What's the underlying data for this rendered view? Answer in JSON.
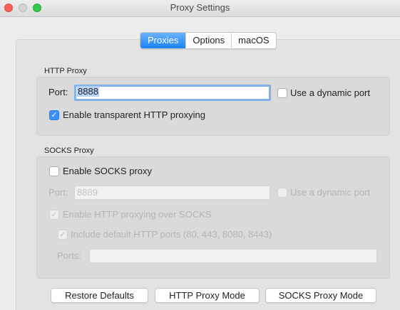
{
  "window": {
    "title": "Proxy Settings"
  },
  "tabs": [
    {
      "label": "Proxies",
      "active": true
    },
    {
      "label": "Options",
      "active": false
    },
    {
      "label": "macOS",
      "active": false
    }
  ],
  "http_proxy": {
    "group_label": "HTTP Proxy",
    "port_label": "Port:",
    "port_value": "8888",
    "dynamic_port_label": "Use a dynamic port",
    "dynamic_port_checked": false,
    "transparent_label": "Enable transparent HTTP proxying",
    "transparent_checked": true
  },
  "socks_proxy": {
    "group_label": "SOCKS Proxy",
    "enable_label": "Enable SOCKS proxy",
    "enable_checked": false,
    "port_label": "Port:",
    "port_value": "8889",
    "dynamic_port_label": "Use a dynamic port",
    "http_over_socks_label": "Enable HTTP proxying over SOCKS",
    "http_over_socks_checked": true,
    "include_default_label": "Include default HTTP ports (80, 443, 8080, 8443)",
    "include_default_checked": true,
    "ports_label": "Ports:",
    "ports_value": ""
  },
  "buttons": {
    "restore_defaults": "Restore Defaults",
    "http_proxy_mode": "HTTP Proxy Mode",
    "socks_proxy_mode": "SOCKS Proxy Mode"
  },
  "colors": {
    "accent": "#1a82fb",
    "close": "#fc605c",
    "zoom": "#34c84a"
  }
}
